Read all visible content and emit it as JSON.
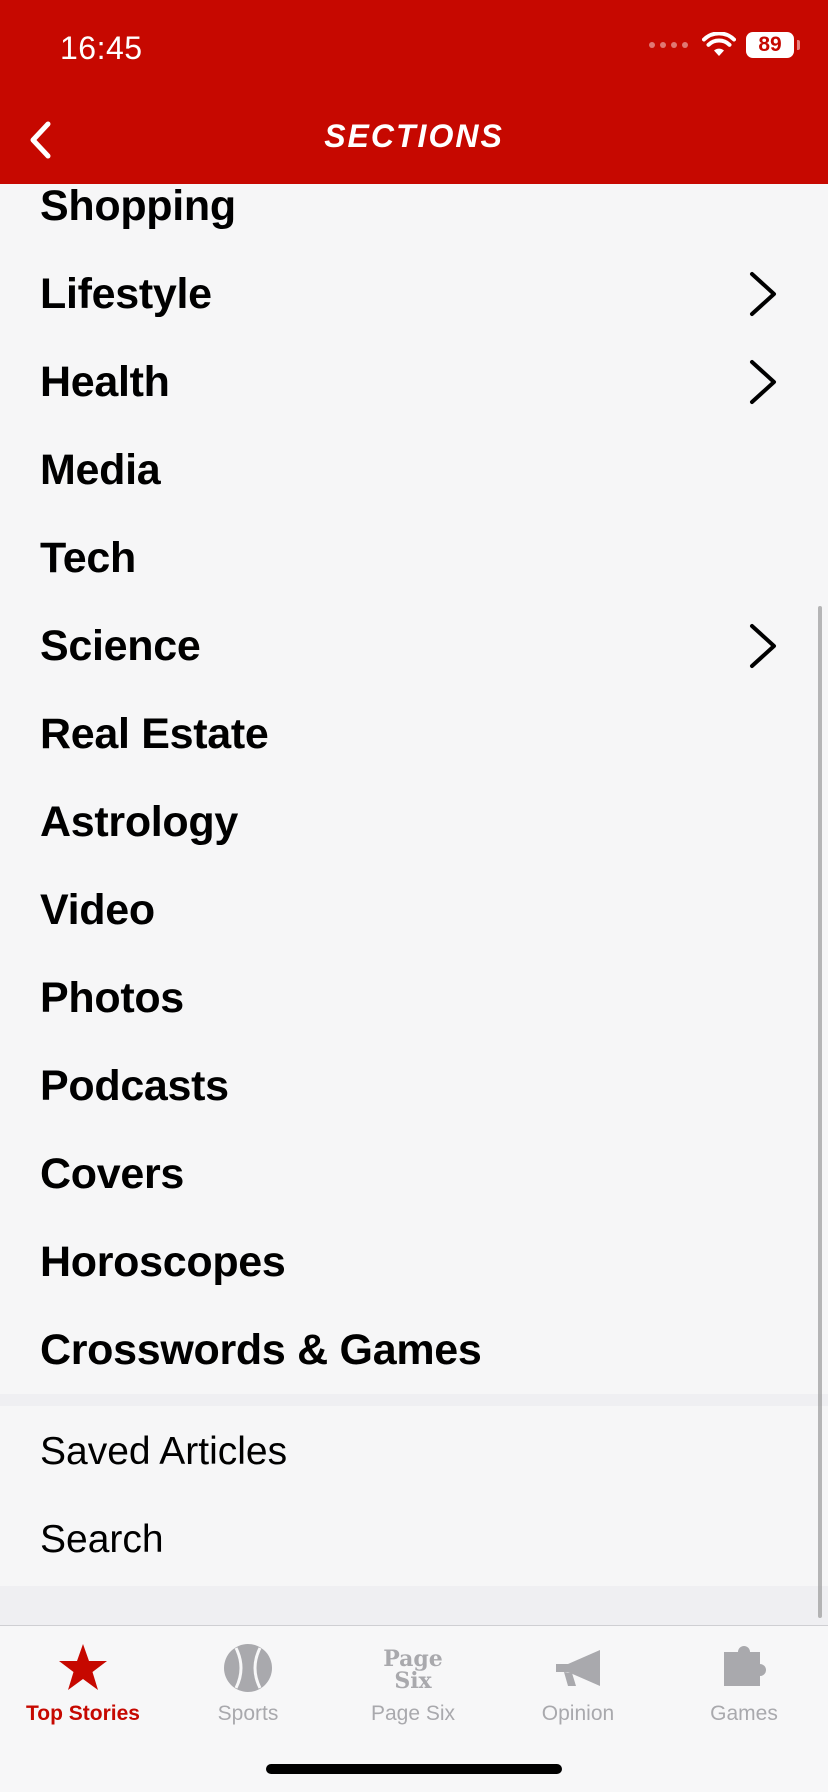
{
  "status": {
    "time": "16:45",
    "battery": "89"
  },
  "header": {
    "title": "SECTIONS"
  },
  "sections": [
    {
      "label": "Shopping",
      "has_children": false
    },
    {
      "label": "Lifestyle",
      "has_children": true
    },
    {
      "label": "Health",
      "has_children": true
    },
    {
      "label": "Media",
      "has_children": false
    },
    {
      "label": "Tech",
      "has_children": false
    },
    {
      "label": "Science",
      "has_children": true
    },
    {
      "label": "Real Estate",
      "has_children": false
    },
    {
      "label": "Astrology",
      "has_children": false
    },
    {
      "label": "Video",
      "has_children": false
    },
    {
      "label": "Photos",
      "has_children": false
    },
    {
      "label": "Podcasts",
      "has_children": false
    },
    {
      "label": "Covers",
      "has_children": false
    },
    {
      "label": "Horoscopes",
      "has_children": false
    },
    {
      "label": "Crosswords & Games",
      "has_children": false
    }
  ],
  "utilities": [
    {
      "label": "Saved Articles"
    },
    {
      "label": "Search"
    }
  ],
  "tabbar": {
    "tabs": [
      {
        "label": "Top Stories",
        "icon": "star-icon",
        "active": true
      },
      {
        "label": "Sports",
        "icon": "baseball-icon",
        "active": false
      },
      {
        "label": "Page Six",
        "icon": "page-six-logo-icon",
        "active": false,
        "logo_text": [
          "Page",
          "Six"
        ]
      },
      {
        "label": "Opinion",
        "icon": "megaphone-icon",
        "active": false
      },
      {
        "label": "Games",
        "icon": "puzzle-piece-icon",
        "active": false
      }
    ]
  },
  "colors": {
    "brand_red": "#c60800",
    "inactive_gray": "#a9a9ad",
    "background": "#f6f6f7"
  }
}
